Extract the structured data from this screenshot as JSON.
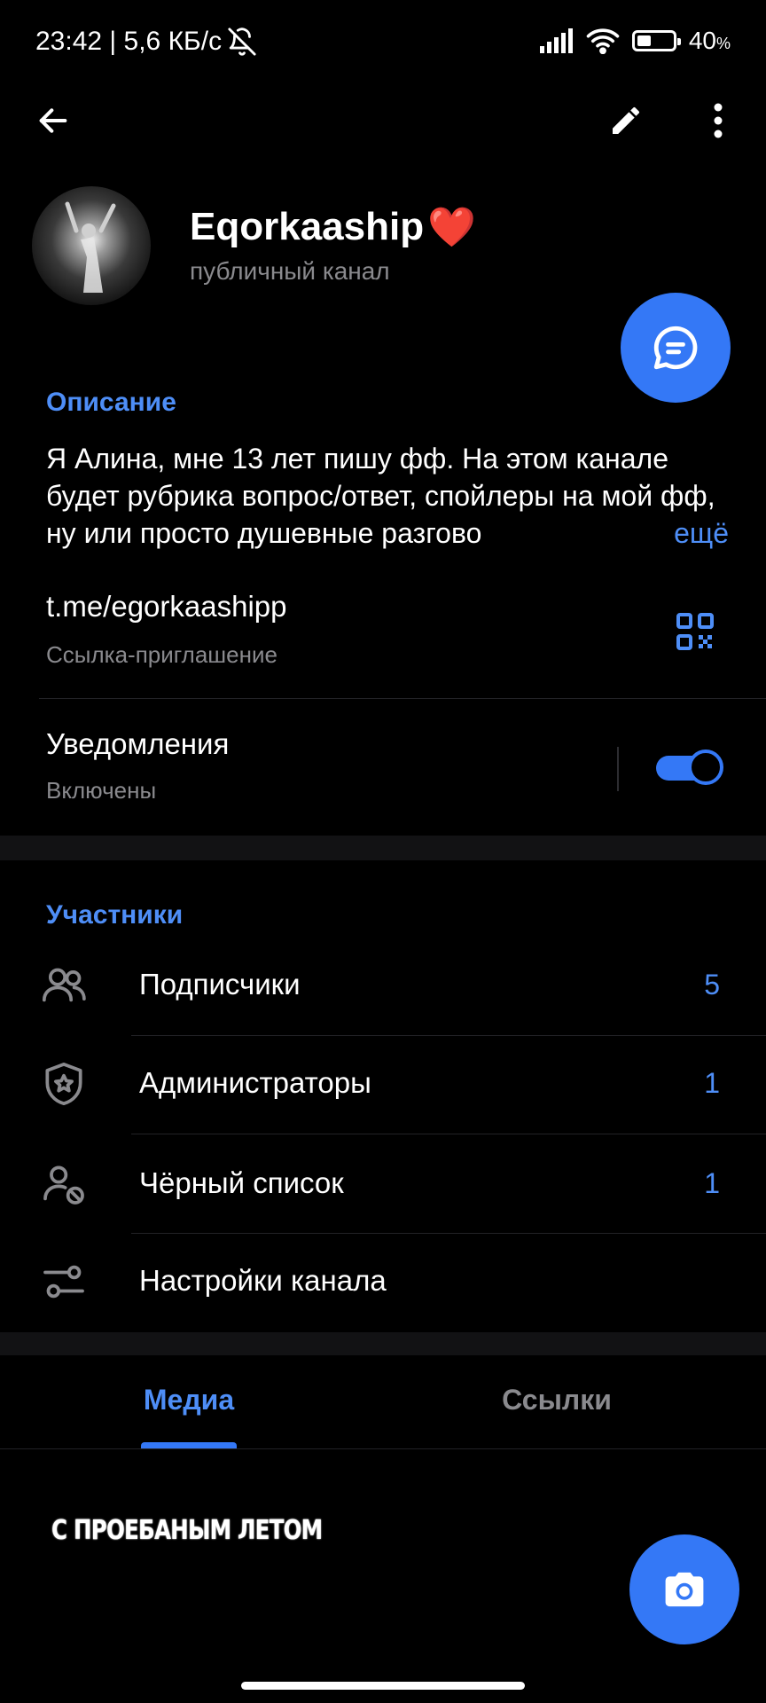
{
  "status_bar": {
    "time_speed": "23:42 | 5,6 КБ/с",
    "battery_percent": "40",
    "battery_unit": "%",
    "battery_level": 0.4
  },
  "toolbar": {
    "back_icon": "arrow-left-icon",
    "edit_icon": "pencil-icon",
    "menu_icon": "more-vertical-icon"
  },
  "channel": {
    "name": "Eqorkaaship",
    "emoji": "❤️",
    "subtitle": "публичный канал"
  },
  "description": {
    "title": "Описание",
    "text": "Я Алина, мне 13 лет пишу фф. На этом канале будет рубрика вопрос/ответ, спойлеры на мой фф, ну или просто душевные разгово",
    "more": "ещё"
  },
  "link": {
    "value": "t.me/egorkaashipp",
    "caption": "Ссылка-приглашение",
    "icon": "qr-code-icon"
  },
  "notifications": {
    "label": "Уведомления",
    "status": "Включены",
    "enabled": true
  },
  "members": {
    "title": "Участники",
    "rows": [
      {
        "label": "Подписчики",
        "count": "5",
        "icon": "users-icon"
      },
      {
        "label": "Администраторы",
        "count": "1",
        "icon": "shield-star-icon"
      },
      {
        "label": "Чёрный список",
        "count": "1",
        "icon": "user-blocked-icon"
      },
      {
        "label": "Настройки канала",
        "count": "",
        "icon": "sliders-icon"
      }
    ]
  },
  "tabs": [
    {
      "label": "Медиа",
      "active": true
    },
    {
      "label": "Ссылки",
      "active": false
    }
  ],
  "media": {
    "caption": "С ПРОЕБАНЫМ ЛЕТОМ"
  },
  "colors": {
    "accent": "#3478f6",
    "accent_text": "#4e8ef7",
    "background": "#000000",
    "secondary_text": "#8a8a8e"
  }
}
